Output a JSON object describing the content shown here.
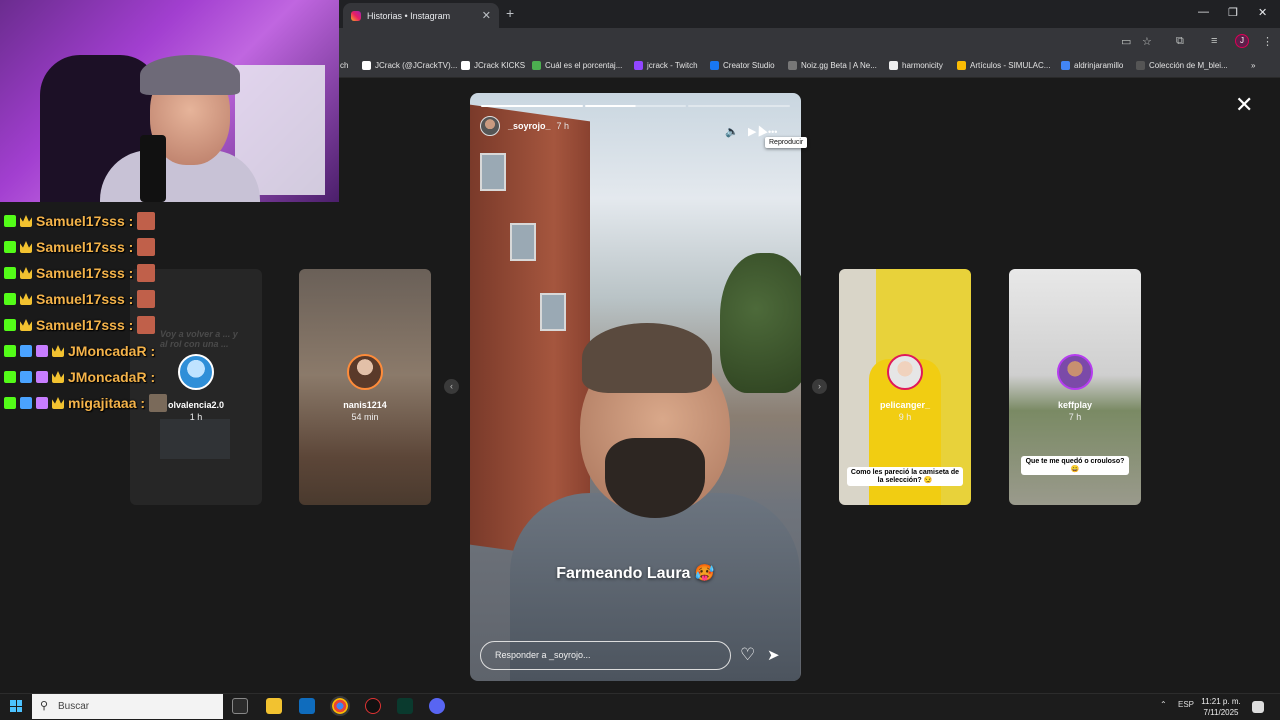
{
  "browser": {
    "tab_title": "Historias • Instagram",
    "tab_close": "✕",
    "new_tab": "+",
    "window_controls": {
      "minimize": "—",
      "restore": "❐",
      "close": "✕"
    },
    "bookmarks": [
      {
        "label": "ch",
        "color": "#35363a"
      },
      {
        "label": "JCrack (@JCrackTV)...",
        "color": "#ffffff"
      },
      {
        "label": "JCrack KICKS",
        "color": "#ffffff"
      },
      {
        "label": "Cuál es el porcentaj...",
        "color": "#4caf50"
      },
      {
        "label": "jcrack - Twitch",
        "color": "#9146ff"
      },
      {
        "label": "Creator Studio",
        "color": "#1877f2"
      },
      {
        "label": "Noiz.gg Beta | A Ne...",
        "color": "#777777"
      },
      {
        "label": "harmonicity",
        "color": "#eeeeee"
      },
      {
        "label": "Artículos - SIMULAC...",
        "color": "#fbbc04"
      },
      {
        "label": "aldrinjaramillo",
        "color": "#4285f4"
      },
      {
        "label": "Colección de M_blei...",
        "color": "#555555"
      }
    ],
    "bookmarks_more": "»"
  },
  "stories": {
    "close": "✕",
    "prev_arrow": "‹",
    "next_arrow": "›",
    "side": [
      {
        "username": "olvalencia2.0",
        "time": "1 h",
        "ghost_text": "Voy a volver a ... y al rol con una ..."
      },
      {
        "username": "nanis1214",
        "time": "54 min"
      },
      {
        "username": "pelicanger_",
        "time": "9 h",
        "caption": "Como les pareció la camiseta de la selección? 😏"
      },
      {
        "username": "keffplay",
        "time": "7 h",
        "caption": "Que te me quedó o crouloso? 😄"
      }
    ],
    "main": {
      "username": "_soyrojo_",
      "time": "7 h",
      "caption": "Farmeando Laura 🥵",
      "reply_placeholder": "Responder a _soyrojo...",
      "tooltip": "Reproducir",
      "icons": {
        "mute": "🔈",
        "play": "▶",
        "more": "•••",
        "heart": "♡",
        "send": "➤"
      },
      "progress_segments": [
        "done",
        "part",
        "empty"
      ]
    }
  },
  "chat": [
    {
      "user": "Samuel17sss :",
      "badges": [
        "kick",
        "crown"
      ]
    },
    {
      "user": "Samuel17sss :",
      "badges": [
        "kick",
        "crown"
      ]
    },
    {
      "user": "Samuel17sss :",
      "badges": [
        "kick",
        "crown"
      ]
    },
    {
      "user": "Samuel17sss :",
      "badges": [
        "kick",
        "crown"
      ]
    },
    {
      "user": "Samuel17sss :",
      "badges": [
        "kick",
        "crown"
      ]
    },
    {
      "user": "JMoncadaR :",
      "badges": [
        "kick",
        "blue",
        "purple",
        "crown"
      ]
    },
    {
      "user": "JMoncadaR :",
      "badges": [
        "kick",
        "blue",
        "purple",
        "crown"
      ]
    },
    {
      "user": "migajitaaa :",
      "badges": [
        "kick",
        "blue",
        "purple",
        "crown"
      ]
    }
  ],
  "taskbar": {
    "search_placeholder": "Buscar",
    "language": "ESP",
    "time": "11:21 p. m.",
    "date": "7/11/2025",
    "tray_up": "⌃"
  }
}
